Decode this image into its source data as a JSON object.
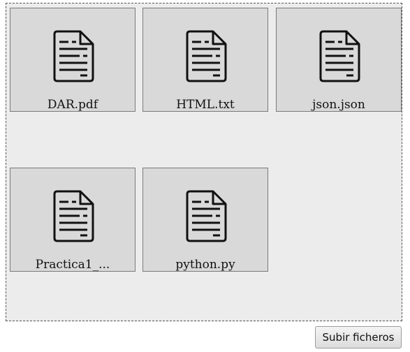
{
  "files": [
    {
      "name": "DAR.pdf",
      "icon": "document-icon"
    },
    {
      "name": "HTML.txt",
      "icon": "document-icon"
    },
    {
      "name": "json.json",
      "icon": "document-icon"
    },
    {
      "name": "Practica1_...",
      "icon": "document-icon"
    },
    {
      "name": "python.py",
      "icon": "document-icon"
    }
  ],
  "upload_button": {
    "label": "Subir ficheros"
  }
}
